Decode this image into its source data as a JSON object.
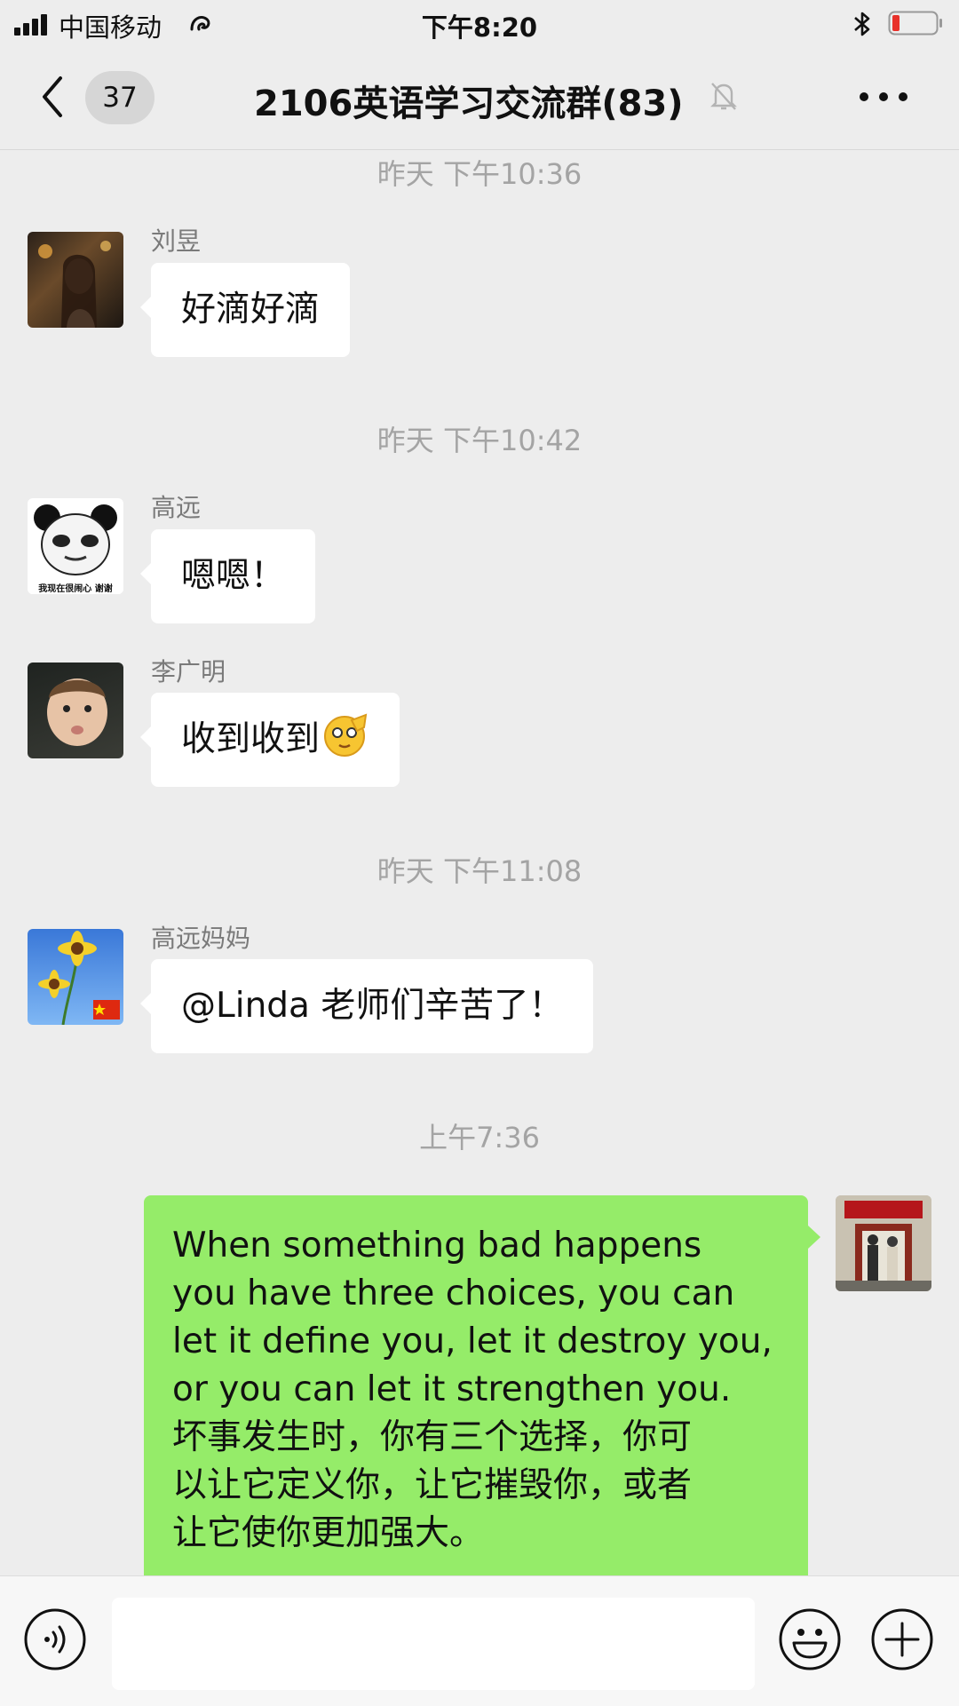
{
  "status": {
    "carrier": "中国移动",
    "time": "下午8:20"
  },
  "nav": {
    "unread_count": "37",
    "title": "2106英语学习交流群(83)"
  },
  "messages": [
    {
      "type": "time",
      "text": "昨天 下午10:36"
    },
    {
      "type": "msg",
      "sender": "刘昱",
      "text": "好滴好滴"
    },
    {
      "type": "time",
      "text": "昨天 下午10:42"
    },
    {
      "type": "msg",
      "sender": "高远",
      "text": "嗯嗯！",
      "avatar_caption": "我现在很闹心 谢谢"
    },
    {
      "type": "msg",
      "sender": "李广明",
      "text": "收到收到"
    },
    {
      "type": "time",
      "text": "昨天 下午11:08"
    },
    {
      "type": "msg",
      "sender": "高远妈妈",
      "text": "@Linda 老师们辛苦了！"
    },
    {
      "type": "time",
      "text": "上午7:36"
    },
    {
      "type": "mine",
      "lines": [
        "When something bad happens",
        "you have three choices, you can",
        "let it define you, let it destroy you,",
        "or you can let it strengthen you.",
        "坏事发生时，你有三个选择，你可",
        "以让它定义你，让它摧毁你，或者",
        "让它使你更加强大。"
      ]
    }
  ],
  "colors": {
    "background": "#ededed",
    "my_bubble": "#95ec69",
    "other_bubble": "#ffffff"
  },
  "icons": [
    "signal-icon",
    "wifi-call-icon",
    "bluetooth-icon",
    "battery-icon",
    "back-chevron-icon",
    "mute-bell-icon",
    "more-icon",
    "voice-icon",
    "emoji-icon",
    "plus-icon"
  ]
}
